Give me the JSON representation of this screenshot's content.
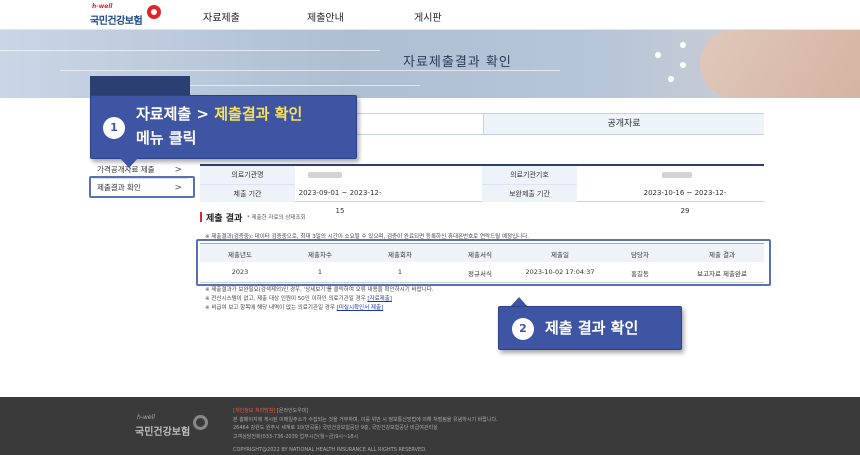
{
  "header": {
    "logo_small": "h-well",
    "logo_name": "국민건강보험",
    "menu": [
      "자료제출",
      "제출안내",
      "게시판"
    ]
  },
  "hero": {
    "title": "자료제출결과 확인"
  },
  "tabs": [
    {
      "label": ""
    },
    {
      "label": "공개자료"
    }
  ],
  "sidebar": {
    "items": [
      {
        "label": "가격공개자료 제출"
      },
      {
        "label": "제출결과 확인"
      }
    ]
  },
  "callout1": {
    "number": "1",
    "line1_white": "자료제출 > ",
    "line1_yellow": "제출결과 확인",
    "line2": "메뉴 클릭"
  },
  "info": {
    "org_label": "의료기관명",
    "code_label": "의료기관기호",
    "period_label": "제출 기간",
    "period_value": "2023-09-01 ~ 2023-12-15",
    "supp_label": "보완제출 기간",
    "supp_value": "2023-10-16 ~ 2023-12-29"
  },
  "result": {
    "title": "제출 결과",
    "subtitle": "* 제출한 자료의 상태조회",
    "note_top": "※ 제출결과(검증중): 데이터 검증중으로, 최대 3일의 시간이 소요될 수 있으며, 검증이 완료되면 등록하신 휴대폰번호로 연락드릴 예정입니다.",
    "columns": [
      "제출년도",
      "제출차수",
      "제출회차",
      "제출서식",
      "제출일",
      "담당자",
      "제출 결과"
    ],
    "rows": [
      [
        "2023",
        "1",
        "1",
        "정규서식",
        "2023-10-02 17:04:37",
        "홍길동",
        "보고자료 제출완료"
      ]
    ],
    "note1": "※ 제출결과가 보완필요(검색제외)인 경우, '상세보기'를 클릭하여 오류 내용을 확인하시기 바랍니다.",
    "note2_prefix": "※ 전산시스템이 없고, 제출 대상 인원이 50인 이하인 의료기관일 경우",
    "note2_link": "[자료제출]",
    "note3_prefix": "※ 비급여 보고 항목에 해당 내역이 없는 의료기관일 경우",
    "note3_link": "[미실시확인서 제출]"
  },
  "callout2": {
    "number": "2",
    "text": "제출 결과 확인"
  },
  "footer": {
    "logo_small": "h-well",
    "logo_name": "국민건강보험",
    "privacy": "[개인정보 처리방침]",
    "email": "[온라인도우미]",
    "line1": "본 홈페이지에 게시된 이메일주소가 수집되는 것을 거부하며, 이를 위반 시 정보통신망법에 의해 처벌됨을 유념하시기 바랍니다.",
    "line2": "26464 강원도 원주시 세계로 10(반곡동) 국민건강보험공단 9층, 국민건강보험공단 비급여관리실",
    "line3": "고객상담전화(033-736-2039 업무시간(월~금)9시~18시",
    "copyright": "COPYRIGHT@2022 BY NATIONAL HEALTH INSURANCE ALL RIGHTS RESERVED."
  }
}
